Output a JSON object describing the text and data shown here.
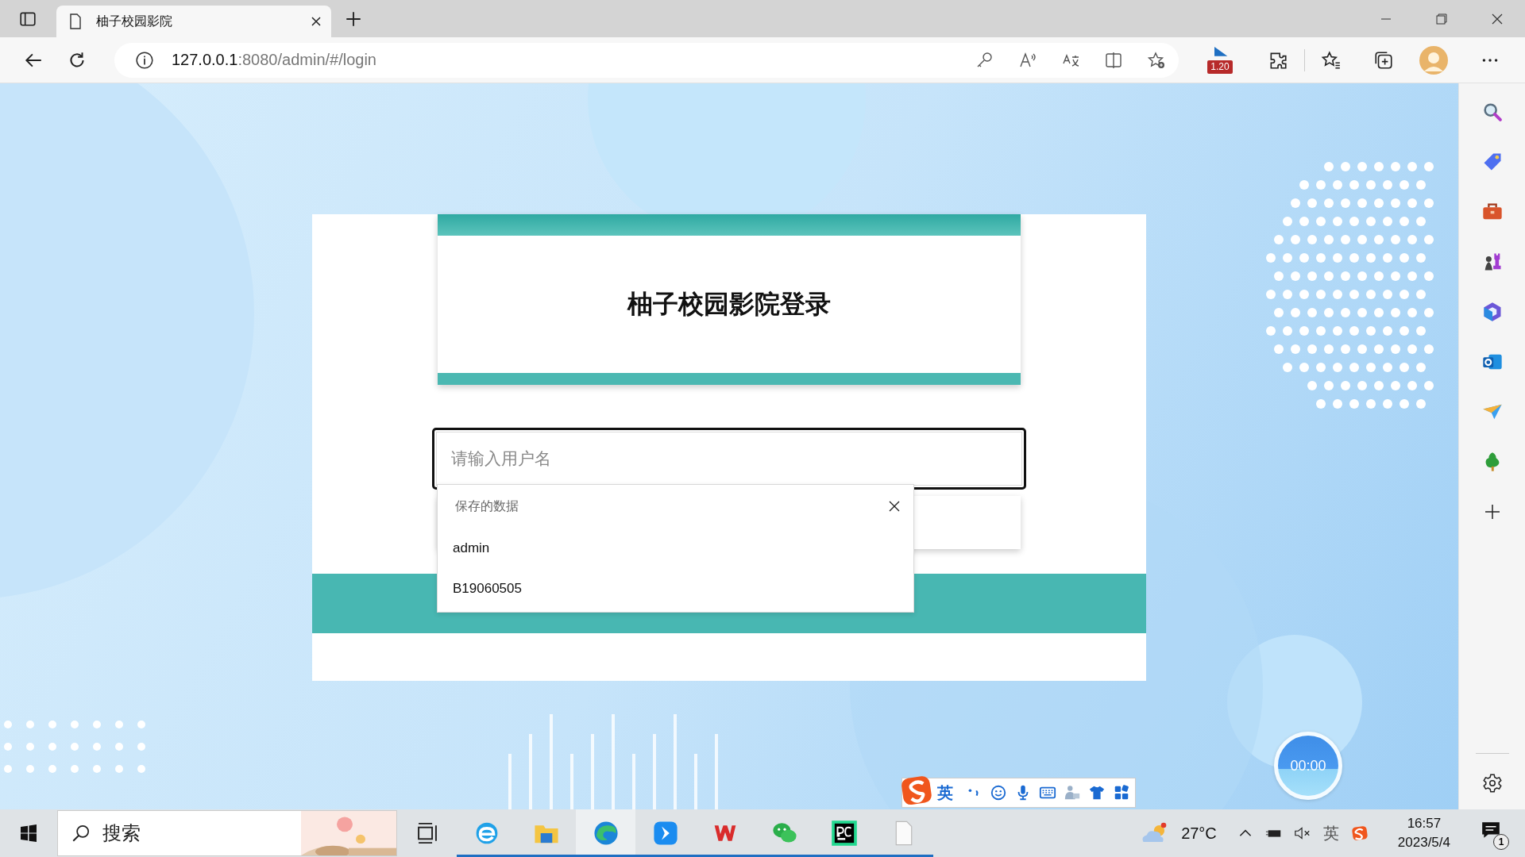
{
  "browser": {
    "tab_title": "柚子校园影院",
    "url_host": "127.0.0.1",
    "url_rest": ":8080/admin/#/login",
    "badge": "1.20"
  },
  "login": {
    "title": "柚子校园影院登录",
    "username": {
      "placeholder": "请输入用户名"
    },
    "autofill": {
      "header": "保存的数据",
      "items": [
        "admin",
        "B19060505"
      ]
    }
  },
  "timer": "00:00",
  "ime_bar": {
    "mode": "英"
  },
  "taskbar": {
    "search_placeholder": "搜索",
    "apps": [
      {
        "kind": "taskview",
        "running": false,
        "selected": false
      },
      {
        "kind": "ie",
        "running": true,
        "selected": false
      },
      {
        "kind": "explorer",
        "running": true,
        "selected": false
      },
      {
        "kind": "edge",
        "running": true,
        "selected": true
      },
      {
        "kind": "feishu",
        "running": true,
        "selected": false
      },
      {
        "kind": "wps",
        "running": true,
        "selected": false
      },
      {
        "kind": "wechat",
        "running": true,
        "selected": false
      },
      {
        "kind": "pycharm",
        "running": true,
        "selected": false
      },
      {
        "kind": "file",
        "running": true,
        "selected": false
      }
    ],
    "weather": "27°C",
    "ime_indicator": "英",
    "time": "16:57",
    "date": "2023/5/4",
    "notifications": "1"
  }
}
